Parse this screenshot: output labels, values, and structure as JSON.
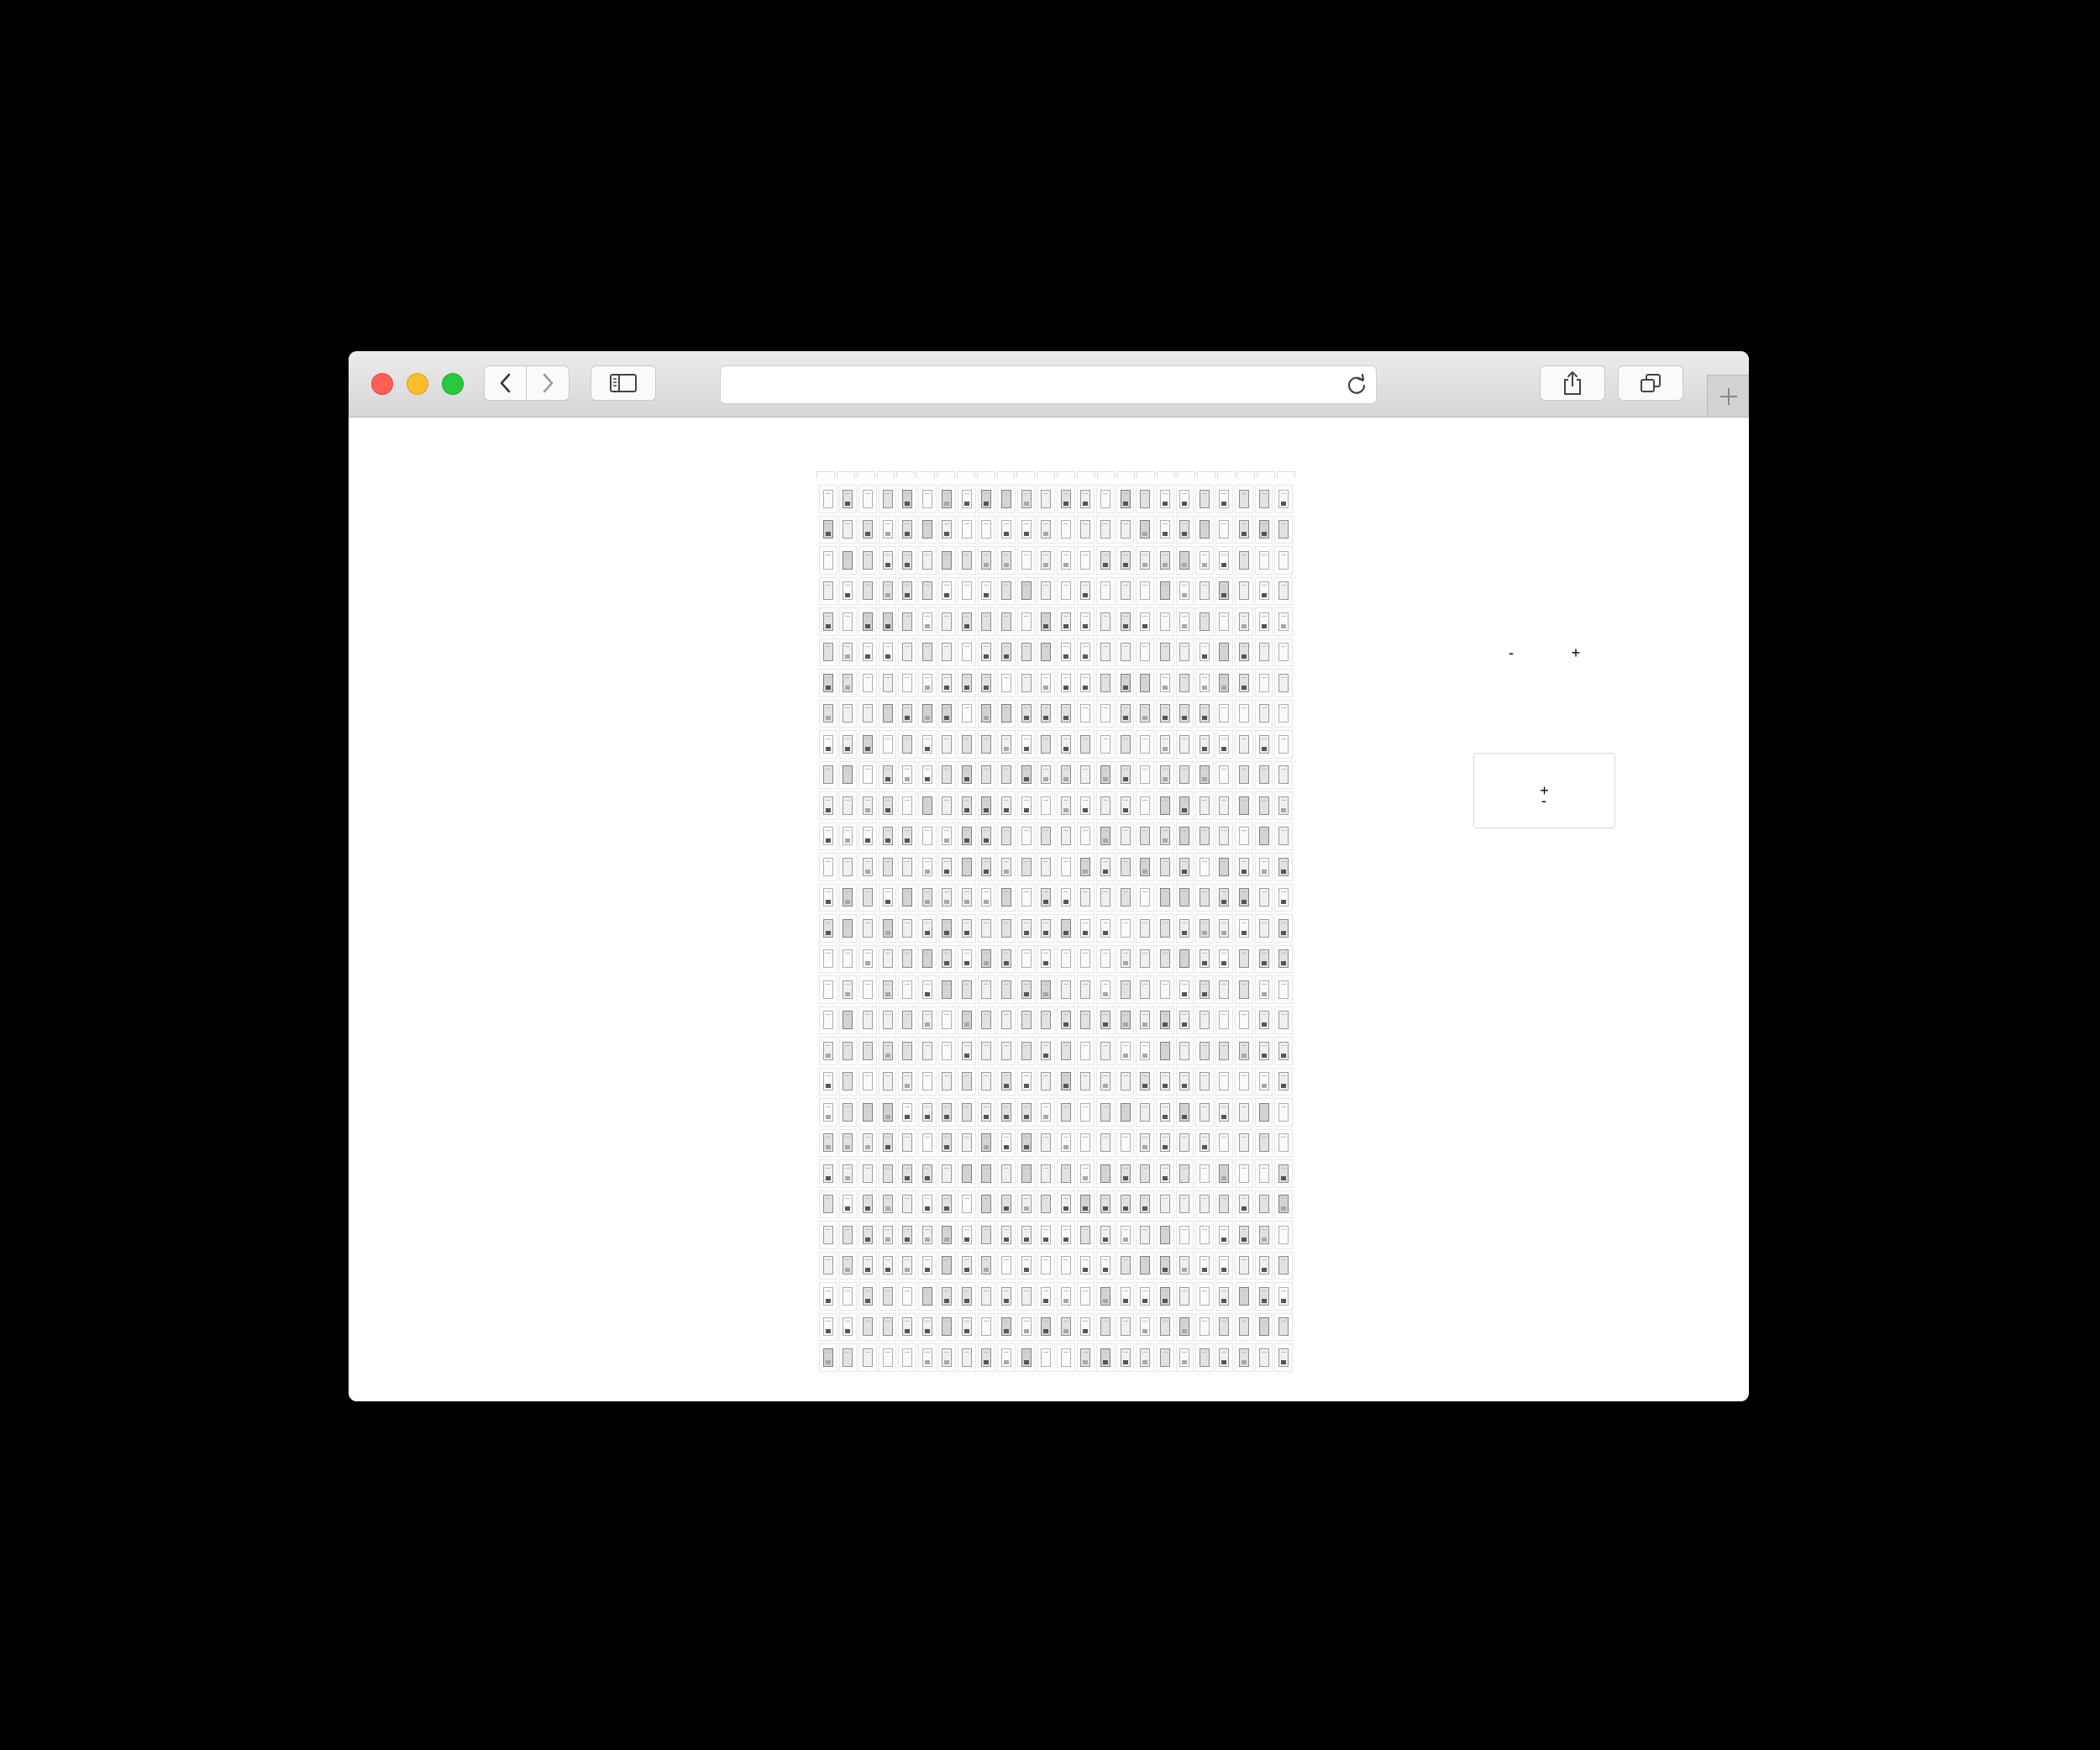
{
  "browser": {
    "url": "",
    "traffic_lights": [
      "close",
      "minimize",
      "zoom"
    ],
    "colors": {
      "close": "#fe5f57",
      "minimize": "#febc2e",
      "zoom": "#28c840"
    },
    "icons": [
      "back-icon",
      "forward-icon",
      "sidebar-icon",
      "reload-icon",
      "share-icon",
      "tabs-icon",
      "new-tab-icon"
    ]
  },
  "controls": {
    "top_minus": "-",
    "top_plus": "+",
    "center_plus": "+",
    "bottom_minus": "-"
  },
  "board": {
    "columns": 24,
    "rows": 29
  }
}
